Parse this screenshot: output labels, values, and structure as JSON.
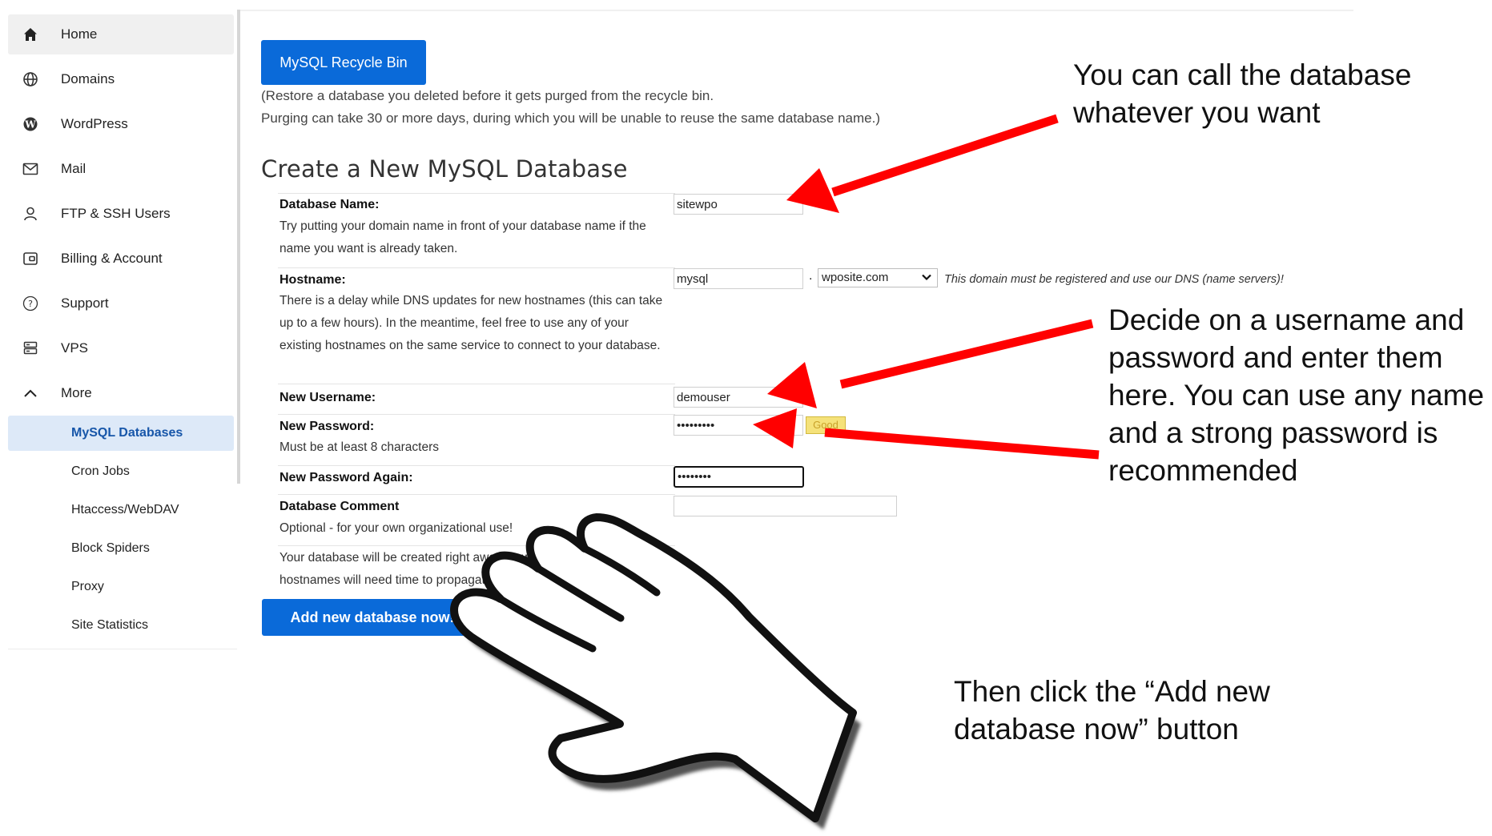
{
  "sidebar": {
    "items": [
      {
        "label": "Home",
        "icon": "home-icon"
      },
      {
        "label": "Domains",
        "icon": "globe-icon"
      },
      {
        "label": "WordPress",
        "icon": "wordpress-icon"
      },
      {
        "label": "Mail",
        "icon": "mail-icon"
      },
      {
        "label": "FTP & SSH Users",
        "icon": "user-icon"
      },
      {
        "label": "Billing & Account",
        "icon": "billing-icon"
      },
      {
        "label": "Support",
        "icon": "help-circle-icon"
      },
      {
        "label": "VPS",
        "icon": "server-icon"
      },
      {
        "label": "More",
        "icon": "chevron-up-icon"
      }
    ],
    "sub_items": [
      {
        "label": "MySQL Databases"
      },
      {
        "label": "Cron Jobs"
      },
      {
        "label": "Htaccess/WebDAV"
      },
      {
        "label": "Block Spiders"
      },
      {
        "label": "Proxy"
      },
      {
        "label": "Site Statistics"
      }
    ],
    "active_item": "Home",
    "active_sub_item": "MySQL Databases"
  },
  "recycle": {
    "button_label": "MySQL Recycle Bin",
    "note_line1": "(Restore a database you deleted before it gets purged from the recycle bin.",
    "note_line2": "Purging can take 30 or more days, during which you will be unable to reuse the same database name.)"
  },
  "form": {
    "title": "Create a New MySQL Database",
    "database_name": {
      "label": "Database Name:",
      "help": "Try putting your domain name in front of your database name if the name you want is already taken.",
      "value": "sitewpo"
    },
    "hostname": {
      "label": "Hostname:",
      "help": "There is a delay while DNS updates for new hostnames (this can take up to a few hours). In the meantime, feel free to use any of your existing hostnames on the same service to connect to your database.",
      "value": "mysql",
      "separator": ".",
      "domain_selected": "wposite.com",
      "domain_note": "This domain must be registered and use our DNS (name servers)!"
    },
    "new_username": {
      "label": "New Username:",
      "value": "demouser"
    },
    "new_password": {
      "label": "New Password:",
      "help": "Must be at least 8 characters",
      "value": "•••••••••",
      "strength": "Good"
    },
    "new_password_again": {
      "label": "New Password Again:",
      "value": "••••••••"
    },
    "database_comment": {
      "label": "Database Comment",
      "help": "Optional - for your own organizational use!",
      "value": ""
    },
    "footer_note": "Your database will be created right away, however new hostnames will need time to propagate.",
    "submit_label": "Add new database now!"
  },
  "annotations": {
    "db_name": [
      "You can call the database",
      "whatever you want"
    ],
    "credentials": [
      "Decide on a username and",
      "password and enter them",
      "here. You can use any name",
      "and a strong password is",
      "recommended"
    ],
    "click": [
      "Then click the “Add new",
      "database now” button"
    ]
  },
  "colors": {
    "primary_button": "#0a6ad9",
    "active_sub_bg": "#dde9f8",
    "active_sub_text": "#1756a9",
    "arrow": "#ff0000",
    "strength_badge": "#f5e27a"
  }
}
